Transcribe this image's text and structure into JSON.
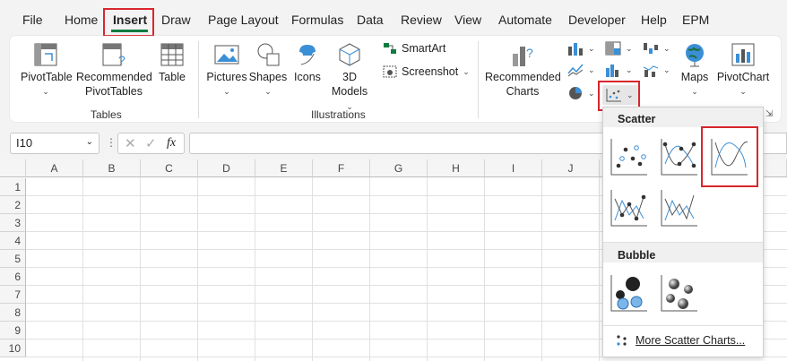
{
  "tabs": [
    "File",
    "Home",
    "Insert",
    "Draw",
    "Page Layout",
    "Formulas",
    "Data",
    "Review",
    "View",
    "Automate",
    "Developer",
    "Help",
    "EPM"
  ],
  "ribbon": {
    "tables": {
      "pivottable": "PivotTable",
      "rec_pivot_line1": "Recommended",
      "rec_pivot_line2": "PivotTables",
      "table": "Table",
      "label": "Tables"
    },
    "illustrations": {
      "pictures": "Pictures",
      "shapes": "Shapes",
      "icons": "Icons",
      "models_line1": "3D",
      "models_line2": "Models",
      "smartart": "SmartArt",
      "screenshot": "Screenshot",
      "label": "Illustrations"
    },
    "charts": {
      "rec_line1": "Recommended",
      "rec_line2": "Charts",
      "maps": "Maps",
      "pivotchart": "PivotChart"
    }
  },
  "formula_bar": {
    "name_box": "I10",
    "fx": "fx"
  },
  "grid": {
    "columns": [
      "A",
      "B",
      "C",
      "D",
      "E",
      "F",
      "G",
      "H",
      "I",
      "J"
    ],
    "rows": [
      "1",
      "2",
      "3",
      "4",
      "5",
      "6",
      "7",
      "8",
      "9",
      "10"
    ]
  },
  "dropdown": {
    "scatter_header": "Scatter",
    "bubble_header": "Bubble",
    "more": "More Scatter Charts..."
  },
  "colors": {
    "accent_red": "#d9262c",
    "excel_green": "#107c41",
    "chart_blue": "#3b8fd6"
  }
}
